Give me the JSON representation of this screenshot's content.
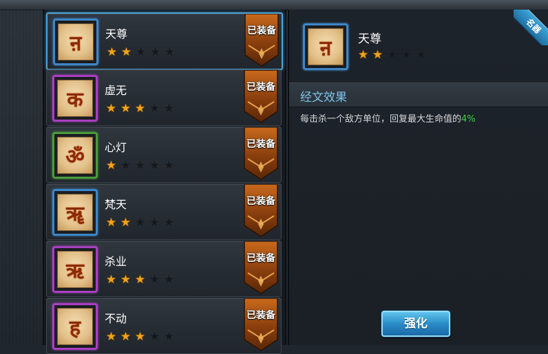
{
  "list": {
    "items": [
      {
        "name": "天尊",
        "stars": 2,
        "frame": "blue",
        "glyph": "ऩ",
        "badge": "已装备",
        "selected": true
      },
      {
        "name": "虚无",
        "stars": 3,
        "frame": "purple",
        "glyph": "क",
        "badge": "已装备",
        "selected": false
      },
      {
        "name": "心灯",
        "stars": 1,
        "frame": "green",
        "glyph": "ॐ",
        "badge": "已装备",
        "selected": false
      },
      {
        "name": "梵天",
        "stars": 2,
        "frame": "blue",
        "glyph": "ॠ",
        "badge": "已装备",
        "selected": false
      },
      {
        "name": "杀业",
        "stars": 3,
        "frame": "purple",
        "glyph": "ऋ",
        "badge": "已装备",
        "selected": false
      },
      {
        "name": "不动",
        "stars": 3,
        "frame": "purple",
        "glyph": "ह",
        "badge": "已装备",
        "selected": false
      }
    ],
    "max_stars": 5
  },
  "detail": {
    "name": "天尊",
    "stars": 2,
    "glyph": "ऩ",
    "corner_tag": "名器",
    "section_title": "经文效果",
    "effect_prefix": "每击杀一个敌方单位，回复最大生命值的",
    "effect_value": "4%",
    "enhance_button": "强化"
  },
  "colors": {
    "star_on": "#f2a21a",
    "frame_blue": "#3e86c6",
    "frame_purple": "#a740c0",
    "frame_green": "#4b9a3a",
    "highlight_green": "#3ed04a",
    "section_title": "#7ec4ea"
  }
}
